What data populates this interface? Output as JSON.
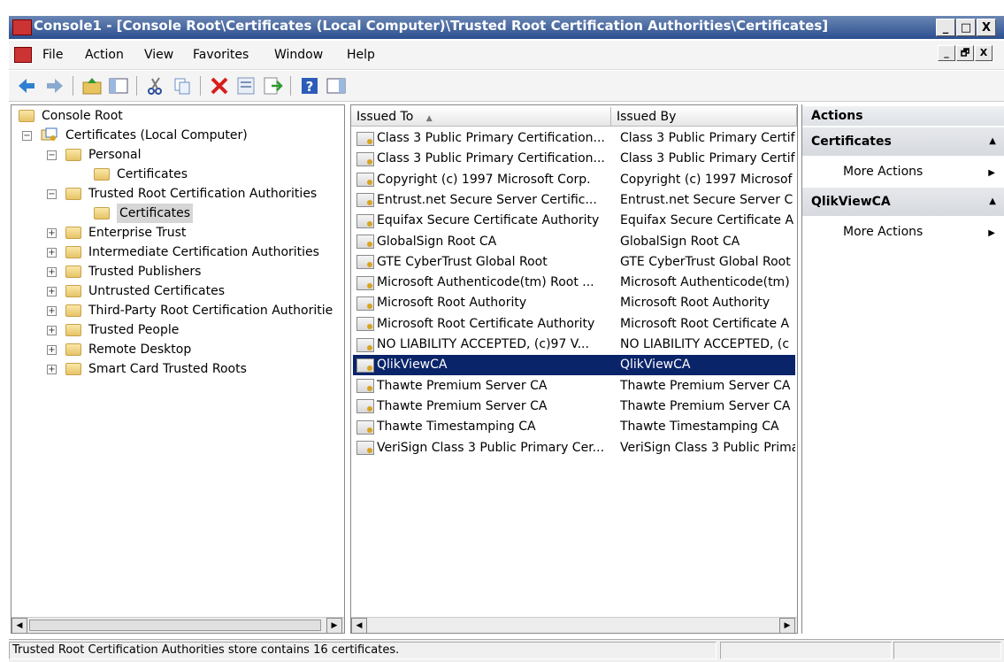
{
  "window": {
    "title": "Console1 - [Console Root\\Certificates (Local Computer)\\Trusted Root Certification Authorities\\Certificates]",
    "minimize": "_",
    "maximize": "□",
    "close": "X",
    "restore": "🗗"
  },
  "menu": [
    "File",
    "Action",
    "View",
    "Favorites",
    "Window",
    "Help"
  ],
  "tree": [
    {
      "label": "Console Root",
      "level": 0,
      "expander": "",
      "icon": "folder-icon"
    },
    {
      "label": "Certificates (Local Computer)",
      "level": 1,
      "expander": "−",
      "icon": "certificates-snapin-icon"
    },
    {
      "label": "Personal",
      "level": 2,
      "expander": "−",
      "icon": "folder-icon"
    },
    {
      "label": "Certificates",
      "level": 3,
      "expander": "",
      "icon": "folder-icon"
    },
    {
      "label": "Trusted Root Certification Authorities",
      "level": 2,
      "expander": "−",
      "icon": "folder-icon"
    },
    {
      "label": "Certificates",
      "level": 3,
      "expander": "",
      "icon": "folder-open-icon",
      "selected": true
    },
    {
      "label": "Enterprise Trust",
      "level": 2,
      "expander": "+",
      "icon": "folder-icon"
    },
    {
      "label": "Intermediate Certification Authorities",
      "level": 2,
      "expander": "+",
      "icon": "folder-icon"
    },
    {
      "label": "Trusted Publishers",
      "level": 2,
      "expander": "+",
      "icon": "folder-icon"
    },
    {
      "label": "Untrusted Certificates",
      "level": 2,
      "expander": "+",
      "icon": "folder-icon"
    },
    {
      "label": "Third-Party Root Certification Authoritie",
      "level": 2,
      "expander": "+",
      "icon": "folder-icon"
    },
    {
      "label": "Trusted People",
      "level": 2,
      "expander": "+",
      "icon": "folder-icon"
    },
    {
      "label": "Remote Desktop",
      "level": 2,
      "expander": "+",
      "icon": "folder-icon"
    },
    {
      "label": "Smart Card Trusted Roots",
      "level": 2,
      "expander": "+",
      "icon": "folder-icon"
    }
  ],
  "list": {
    "columns": [
      "Issued To",
      "Issued By"
    ],
    "sort_indicator": "▲",
    "rows": [
      {
        "issued_to": "Class 3 Public Primary Certification...",
        "issued_by": "Class 3 Public Primary Certif"
      },
      {
        "issued_to": "Class 3 Public Primary Certification...",
        "issued_by": "Class 3 Public Primary Certif"
      },
      {
        "issued_to": "Copyright (c) 1997 Microsoft Corp.",
        "issued_by": "Copyright (c) 1997 Microsof"
      },
      {
        "issued_to": "Entrust.net Secure Server Certific...",
        "issued_by": "Entrust.net Secure Server C"
      },
      {
        "issued_to": "Equifax Secure Certificate Authority",
        "issued_by": "Equifax Secure Certificate A"
      },
      {
        "issued_to": "GlobalSign Root CA",
        "issued_by": "GlobalSign Root CA"
      },
      {
        "issued_to": "GTE CyberTrust Global Root",
        "issued_by": "GTE CyberTrust Global Root"
      },
      {
        "issued_to": "Microsoft Authenticode(tm) Root ...",
        "issued_by": "Microsoft Authenticode(tm)"
      },
      {
        "issued_to": "Microsoft Root Authority",
        "issued_by": "Microsoft Root Authority"
      },
      {
        "issued_to": "Microsoft Root Certificate Authority",
        "issued_by": "Microsoft Root Certificate A"
      },
      {
        "issued_to": "NO LIABILITY ACCEPTED, (c)97 V...",
        "issued_by": "NO LIABILITY ACCEPTED, (c"
      },
      {
        "issued_to": "QlikViewCA",
        "issued_by": "QlikViewCA",
        "selected": true
      },
      {
        "issued_to": "Thawte Premium Server CA",
        "issued_by": "Thawte Premium Server CA"
      },
      {
        "issued_to": "Thawte Premium Server CA",
        "issued_by": "Thawte Premium Server CA"
      },
      {
        "issued_to": "Thawte Timestamping CA",
        "issued_by": "Thawte Timestamping CA"
      },
      {
        "issued_to": "VeriSign Class 3 Public Primary Cer...",
        "issued_by": "VeriSign Class 3 Public Prima"
      }
    ]
  },
  "actions": {
    "header": "Actions",
    "groups": [
      {
        "title": "Certificates",
        "items": [
          "More Actions"
        ]
      },
      {
        "title": "QlikViewCA",
        "items": [
          "More Actions"
        ]
      }
    ]
  },
  "toolbar": {
    "icons": [
      "back-arrow-icon",
      "forward-arrow-icon",
      "up-folder-icon",
      "show-hide-tree-icon",
      "cut-icon",
      "copy-icon",
      "delete-icon",
      "properties-icon",
      "export-list-icon",
      "help-icon",
      "show-hide-action-pane-icon"
    ]
  },
  "statusbar": {
    "text": "Trusted Root Certification Authorities store contains 16 certificates."
  },
  "colors": {
    "selection": "#0a246a",
    "titlebar": "#2b4f8f"
  }
}
